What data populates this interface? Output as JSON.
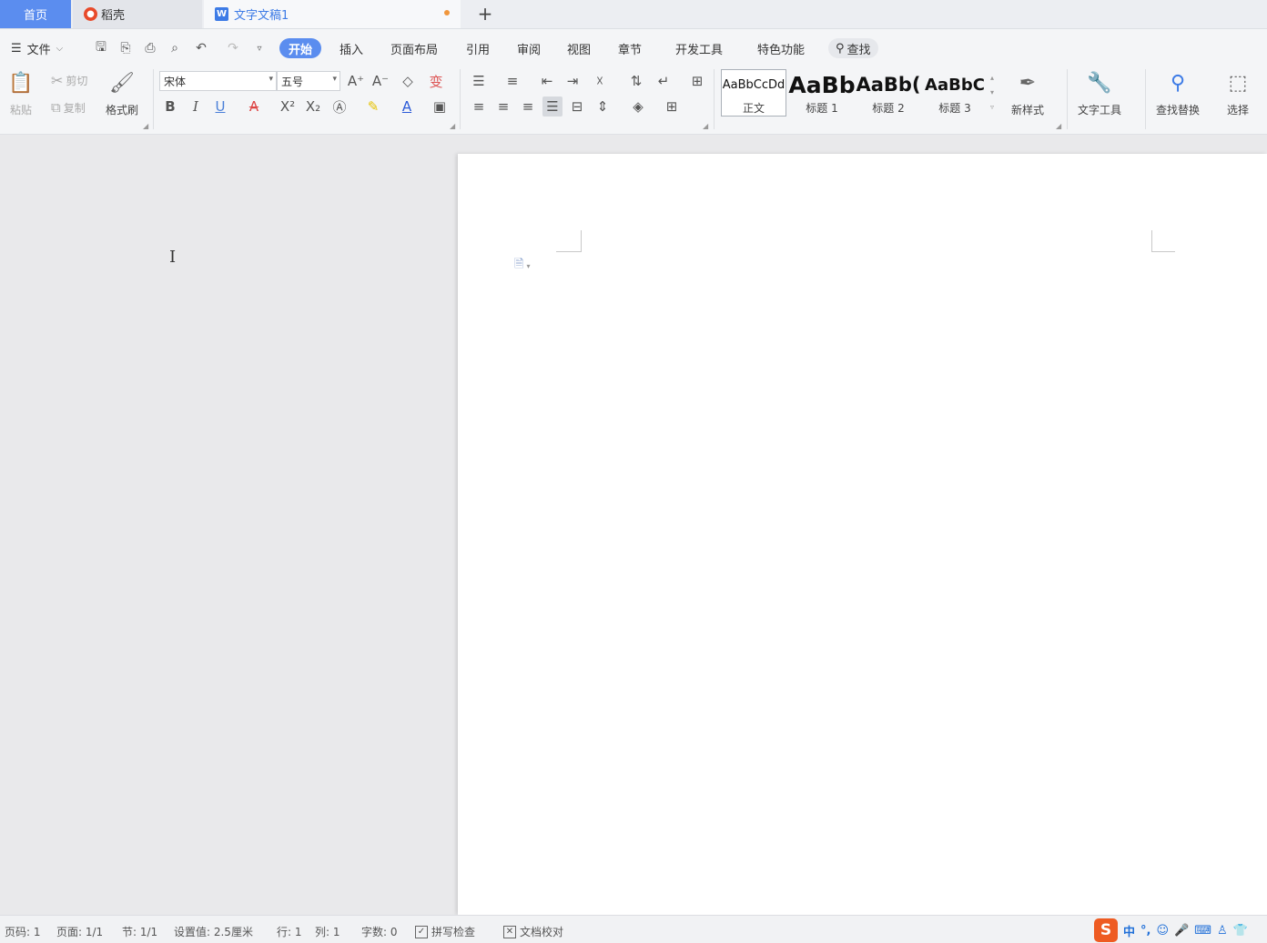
{
  "tabs": {
    "home": "首页",
    "daoke": "稻壳",
    "doc": "文字文稿1",
    "add": "+"
  },
  "menu": {
    "file": "文件",
    "items": [
      "开始",
      "插入",
      "页面布局",
      "引用",
      "审阅",
      "视图",
      "章节",
      "开发工具",
      "特色功能"
    ],
    "search": "查找"
  },
  "ribbon": {
    "paste": "粘贴",
    "cut": "剪切",
    "copy": "复制",
    "format_painter": "格式刷",
    "font_name": "宋体",
    "font_size": "五号",
    "styles": [
      {
        "preview": "AaBbCcDd",
        "caption": "正文"
      },
      {
        "preview": "AaBb",
        "caption": "标题 1"
      },
      {
        "preview": "AaBb(",
        "caption": "标题 2"
      },
      {
        "preview": "AaBbC",
        "caption": "标题 3"
      }
    ],
    "new_style": "新样式",
    "text_tools": "文字工具",
    "find_replace": "查找替换",
    "select": "选择"
  },
  "status": {
    "page_no": "页码: 1",
    "page": "页面: 1/1",
    "section": "节: 1/1",
    "setting": "设置值: 2.5厘米",
    "row": "行: 1",
    "col": "列: 1",
    "words": "字数: 0",
    "spell": "拼写检查",
    "proof": "文档校对"
  },
  "ime": {
    "logo": "S",
    "lang": "中"
  },
  "colors": {
    "accent": "#5b8def",
    "doc_tab_text": "#3d7be6",
    "unsaved_dot": "#f0963c"
  }
}
